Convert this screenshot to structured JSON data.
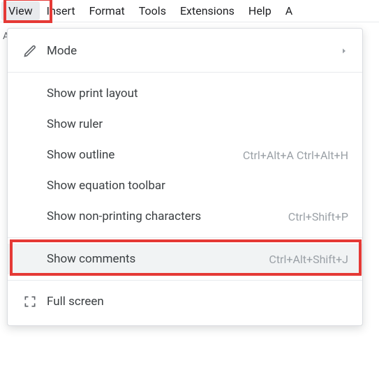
{
  "menubar": {
    "items": [
      {
        "label": "View",
        "active": true
      },
      {
        "label": "Insert",
        "active": false
      },
      {
        "label": "Format",
        "active": false
      },
      {
        "label": "Tools",
        "active": false
      },
      {
        "label": "Extensions",
        "active": false
      },
      {
        "label": "Help",
        "active": false
      },
      {
        "label": "A",
        "active": false
      }
    ]
  },
  "toolbar_left_fragment": "A",
  "dropdown": {
    "mode": {
      "label": "Mode"
    },
    "items": [
      {
        "label": "Show print layout",
        "shortcut": ""
      },
      {
        "label": "Show ruler",
        "shortcut": ""
      },
      {
        "label": "Show outline",
        "shortcut": "Ctrl+Alt+A Ctrl+Alt+H"
      },
      {
        "label": "Show equation toolbar",
        "shortcut": ""
      },
      {
        "label": "Show non-printing characters",
        "shortcut": "Ctrl+Shift+P"
      }
    ],
    "comments": {
      "label": "Show comments",
      "shortcut": "Ctrl+Alt+Shift+J"
    },
    "fullscreen": {
      "label": "Full screen"
    }
  }
}
